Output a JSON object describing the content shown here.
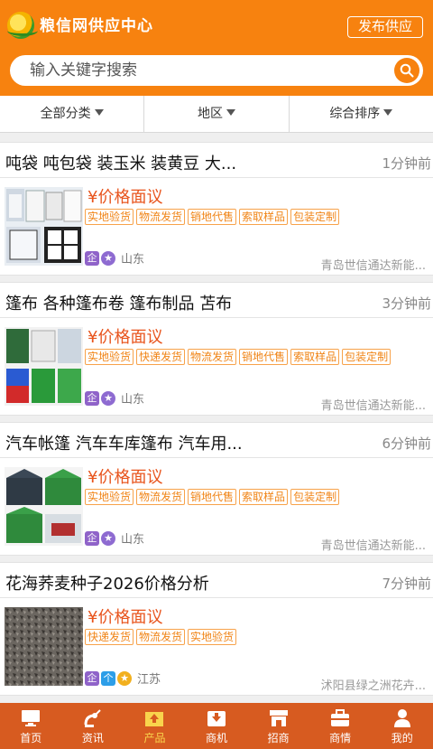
{
  "header": {
    "title": "粮信网供应中心",
    "publish_label": "发布供应",
    "search_placeholder": "输入关键字搜索"
  },
  "filters": [
    {
      "label": "全部分类"
    },
    {
      "label": "地区"
    },
    {
      "label": "综合排序"
    }
  ],
  "listings": [
    {
      "title": "吨袋 吨包袋 装玉米 装黄豆 大...",
      "time": "1分钟前",
      "price": "¥价格面议",
      "tags": [
        "实地验货",
        "物流发货",
        "销地代售",
        "索取样品",
        "包装定制"
      ],
      "region": "山东",
      "company": "青岛世信通达新能..."
    },
    {
      "title": "篷布 各种篷布卷 篷布制品 苫布",
      "time": "3分钟前",
      "price": "¥价格面议",
      "tags": [
        "实地验货",
        "快递发货",
        "物流发货",
        "销地代售",
        "索取样品",
        "包装定制"
      ],
      "region": "山东",
      "company": "青岛世信通达新能..."
    },
    {
      "title": "汽车帐篷 汽车车库篷布 汽车用...",
      "time": "6分钟前",
      "price": "¥价格面议",
      "tags": [
        "实地验货",
        "物流发货",
        "销地代售",
        "索取样品",
        "包装定制"
      ],
      "region": "山东",
      "company": "青岛世信通达新能..."
    },
    {
      "title": "花海荞麦种子2026价格分析",
      "time": "7分钟前",
      "price": "¥价格面议",
      "tags": [
        "快递发货",
        "物流发货",
        "实地验货"
      ],
      "region": "江苏",
      "company": "沭阳县绿之洲花卉..."
    }
  ],
  "badges": {
    "enterprise": "企",
    "personal": "个"
  },
  "tabbar": [
    {
      "label": "首页",
      "icon": "monitor-icon"
    },
    {
      "label": "资讯",
      "icon": "satellite-icon"
    },
    {
      "label": "产品",
      "icon": "box-icon"
    },
    {
      "label": "商机",
      "icon": "inbox-icon"
    },
    {
      "label": "招商",
      "icon": "store-icon"
    },
    {
      "label": "商情",
      "icon": "briefcase-icon"
    },
    {
      "label": "我的",
      "icon": "user-icon"
    }
  ],
  "colors": {
    "brand": "#f7820f",
    "tabbar": "#d75b20",
    "price": "#e8541c",
    "active_tab": "#f9d44c"
  }
}
